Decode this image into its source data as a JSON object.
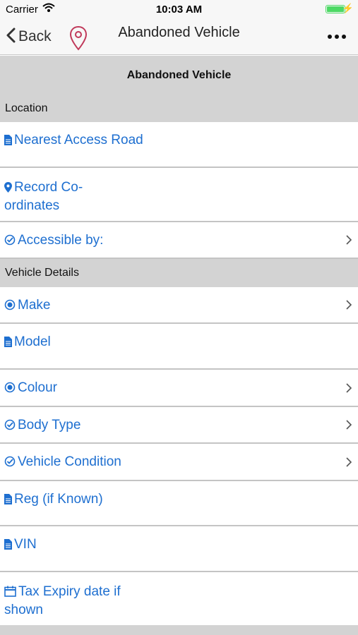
{
  "status_bar": {
    "carrier": "Carrier",
    "time": "10:03 AM"
  },
  "nav": {
    "back_label": "Back",
    "title": "Abandoned Vehicle"
  },
  "form_header": "Abandoned Vehicle",
  "sections": {
    "location": "Location",
    "vehicle_details": "Vehicle Details"
  },
  "fields": {
    "nearest_access_road": "Nearest Access Road",
    "record_coordinates": "Record Co-ordinates",
    "accessible_by": "Accessible by:",
    "make": "Make",
    "model": "Model",
    "colour": "Colour",
    "body_type": "Body Type",
    "vehicle_condition": "Vehicle Condition",
    "reg": "Reg (if Known)",
    "vin": "VIN",
    "tax_expiry": "Tax Expiry date if shown"
  },
  "icons": {
    "text_field": "document-icon",
    "location": "map-pin-icon",
    "checklist": "check-circle-icon",
    "single_choice": "radio-icon",
    "date": "calendar-icon",
    "disclosure": "chevron-right-icon"
  },
  "colors": {
    "accent": "#1e6fd0",
    "section_bg": "#d3d3d3",
    "pin": "#c0395a",
    "battery": "#4cd964"
  }
}
